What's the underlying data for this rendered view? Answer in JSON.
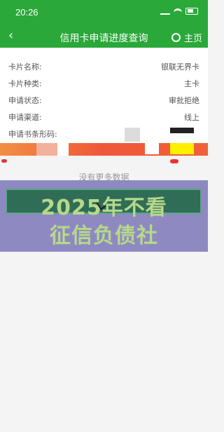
{
  "status": {
    "time": "20:26"
  },
  "nav": {
    "back_icon": "‹",
    "title": "信用卡申请进度查询",
    "home_label": "主页"
  },
  "details": {
    "rows": [
      {
        "label": "卡片名称:",
        "value": "银联无界卡"
      },
      {
        "label": "卡片种类:",
        "value": "主卡"
      },
      {
        "label": "申请状态:",
        "value": "审批拒绝"
      },
      {
        "label": "申请渠道:",
        "value": "线上"
      },
      {
        "label": "申请书条形码:",
        "value": ""
      }
    ]
  },
  "footer": {
    "no_more": "没有更多数据"
  },
  "overlay": {
    "line1": "2025年不看",
    "line2": "征信负债社"
  }
}
